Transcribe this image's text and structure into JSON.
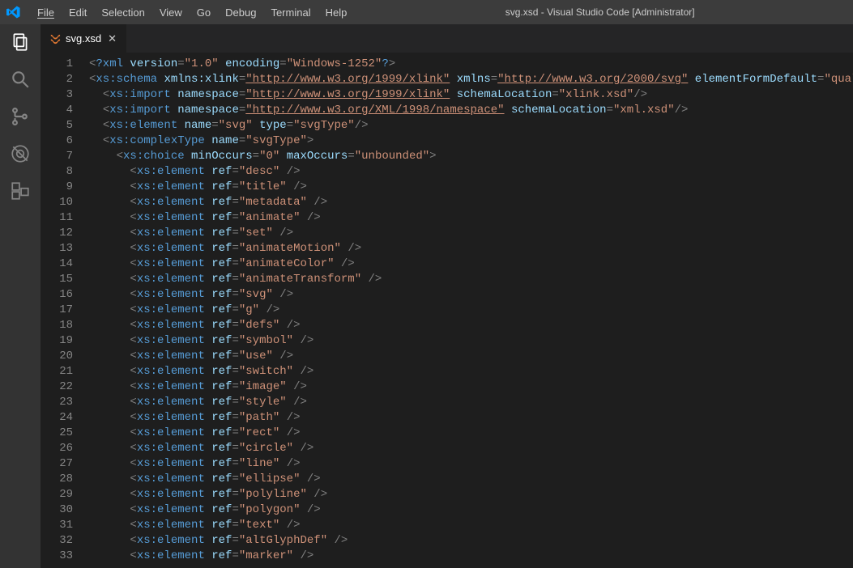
{
  "titlebar": {
    "title": "svg.xsd - Visual Studio Code [Administrator]",
    "menu": [
      "File",
      "Edit",
      "Selection",
      "View",
      "Go",
      "Debug",
      "Terminal",
      "Help"
    ]
  },
  "activitybar": {
    "items": [
      "explorer-icon",
      "search-icon",
      "source-control-icon",
      "debug-icon",
      "extensions-icon"
    ]
  },
  "tabs": [
    {
      "label": "svg.xsd",
      "icon": "xml-icon"
    }
  ],
  "indent": "  ",
  "code_lines": [
    {
      "n": 1,
      "i": 0,
      "t": [
        [
          "punc",
          "<"
        ],
        [
          "pi",
          "?xml"
        ],
        [
          "plain",
          " "
        ],
        [
          "attr",
          "version"
        ],
        [
          "punc",
          "="
        ],
        [
          "str",
          "\"1.0\""
        ],
        [
          "plain",
          " "
        ],
        [
          "attr",
          "encoding"
        ],
        [
          "punc",
          "="
        ],
        [
          "str",
          "\"Windows-1252\""
        ],
        [
          "pi",
          "?"
        ],
        [
          "punc",
          ">"
        ]
      ]
    },
    {
      "n": 2,
      "i": 0,
      "t": [
        [
          "punc",
          "<"
        ],
        [
          "tag",
          "xs:schema"
        ],
        [
          "plain",
          " "
        ],
        [
          "attr",
          "xmlns:xlink"
        ],
        [
          "punc",
          "="
        ],
        [
          "url",
          "\"http://www.w3.org/1999/xlink\""
        ],
        [
          "plain",
          " "
        ],
        [
          "attr",
          "xmlns"
        ],
        [
          "punc",
          "="
        ],
        [
          "url",
          "\"http://www.w3.org/2000/svg\""
        ],
        [
          "plain",
          " "
        ],
        [
          "attr",
          "elementFormDefault"
        ],
        [
          "punc",
          "="
        ],
        [
          "str",
          "\"qualified\""
        ]
      ]
    },
    {
      "n": 3,
      "i": 1,
      "t": [
        [
          "punc",
          "<"
        ],
        [
          "tag",
          "xs:import"
        ],
        [
          "plain",
          " "
        ],
        [
          "attr",
          "namespace"
        ],
        [
          "punc",
          "="
        ],
        [
          "url",
          "\"http://www.w3.org/1999/xlink\""
        ],
        [
          "plain",
          " "
        ],
        [
          "attr",
          "schemaLocation"
        ],
        [
          "punc",
          "="
        ],
        [
          "str",
          "\"xlink.xsd\""
        ],
        [
          "punc",
          "/>"
        ]
      ]
    },
    {
      "n": 4,
      "i": 1,
      "t": [
        [
          "punc",
          "<"
        ],
        [
          "tag",
          "xs:import"
        ],
        [
          "plain",
          " "
        ],
        [
          "attr",
          "namespace"
        ],
        [
          "punc",
          "="
        ],
        [
          "url",
          "\"http://www.w3.org/XML/1998/namespace\""
        ],
        [
          "plain",
          " "
        ],
        [
          "attr",
          "schemaLocation"
        ],
        [
          "punc",
          "="
        ],
        [
          "str",
          "\"xml.xsd\""
        ],
        [
          "punc",
          "/>"
        ]
      ]
    },
    {
      "n": 5,
      "i": 1,
      "t": [
        [
          "punc",
          "<"
        ],
        [
          "tag",
          "xs:element"
        ],
        [
          "plain",
          " "
        ],
        [
          "attr",
          "name"
        ],
        [
          "punc",
          "="
        ],
        [
          "str",
          "\"svg\""
        ],
        [
          "plain",
          " "
        ],
        [
          "attr",
          "type"
        ],
        [
          "punc",
          "="
        ],
        [
          "str",
          "\"svgType\""
        ],
        [
          "punc",
          "/>"
        ]
      ]
    },
    {
      "n": 6,
      "i": 1,
      "t": [
        [
          "punc",
          "<"
        ],
        [
          "tag",
          "xs:complexType"
        ],
        [
          "plain",
          " "
        ],
        [
          "attr",
          "name"
        ],
        [
          "punc",
          "="
        ],
        [
          "str",
          "\"svgType\""
        ],
        [
          "punc",
          ">"
        ]
      ]
    },
    {
      "n": 7,
      "i": 2,
      "t": [
        [
          "punc",
          "<"
        ],
        [
          "tag",
          "xs:choice"
        ],
        [
          "plain",
          " "
        ],
        [
          "attr",
          "minOccurs"
        ],
        [
          "punc",
          "="
        ],
        [
          "str",
          "\"0\""
        ],
        [
          "plain",
          " "
        ],
        [
          "attr",
          "maxOccurs"
        ],
        [
          "punc",
          "="
        ],
        [
          "str",
          "\"unbounded\""
        ],
        [
          "punc",
          ">"
        ]
      ]
    },
    {
      "n": 8,
      "i": 3,
      "t": [
        [
          "punc",
          "<"
        ],
        [
          "tag",
          "xs:element"
        ],
        [
          "plain",
          " "
        ],
        [
          "attr",
          "ref"
        ],
        [
          "punc",
          "="
        ],
        [
          "str",
          "\"desc\""
        ],
        [
          "plain",
          " "
        ],
        [
          "punc",
          "/>"
        ]
      ]
    },
    {
      "n": 9,
      "i": 3,
      "t": [
        [
          "punc",
          "<"
        ],
        [
          "tag",
          "xs:element"
        ],
        [
          "plain",
          " "
        ],
        [
          "attr",
          "ref"
        ],
        [
          "punc",
          "="
        ],
        [
          "str",
          "\"title\""
        ],
        [
          "plain",
          " "
        ],
        [
          "punc",
          "/>"
        ]
      ]
    },
    {
      "n": 10,
      "i": 3,
      "t": [
        [
          "punc",
          "<"
        ],
        [
          "tag",
          "xs:element"
        ],
        [
          "plain",
          " "
        ],
        [
          "attr",
          "ref"
        ],
        [
          "punc",
          "="
        ],
        [
          "str",
          "\"metadata\""
        ],
        [
          "plain",
          " "
        ],
        [
          "punc",
          "/>"
        ]
      ]
    },
    {
      "n": 11,
      "i": 3,
      "t": [
        [
          "punc",
          "<"
        ],
        [
          "tag",
          "xs:element"
        ],
        [
          "plain",
          " "
        ],
        [
          "attr",
          "ref"
        ],
        [
          "punc",
          "="
        ],
        [
          "str",
          "\"animate\""
        ],
        [
          "plain",
          " "
        ],
        [
          "punc",
          "/>"
        ]
      ]
    },
    {
      "n": 12,
      "i": 3,
      "t": [
        [
          "punc",
          "<"
        ],
        [
          "tag",
          "xs:element"
        ],
        [
          "plain",
          " "
        ],
        [
          "attr",
          "ref"
        ],
        [
          "punc",
          "="
        ],
        [
          "str",
          "\"set\""
        ],
        [
          "plain",
          " "
        ],
        [
          "punc",
          "/>"
        ]
      ]
    },
    {
      "n": 13,
      "i": 3,
      "t": [
        [
          "punc",
          "<"
        ],
        [
          "tag",
          "xs:element"
        ],
        [
          "plain",
          " "
        ],
        [
          "attr",
          "ref"
        ],
        [
          "punc",
          "="
        ],
        [
          "str",
          "\"animateMotion\""
        ],
        [
          "plain",
          " "
        ],
        [
          "punc",
          "/>"
        ]
      ]
    },
    {
      "n": 14,
      "i": 3,
      "t": [
        [
          "punc",
          "<"
        ],
        [
          "tag",
          "xs:element"
        ],
        [
          "plain",
          " "
        ],
        [
          "attr",
          "ref"
        ],
        [
          "punc",
          "="
        ],
        [
          "str",
          "\"animateColor\""
        ],
        [
          "plain",
          " "
        ],
        [
          "punc",
          "/>"
        ]
      ]
    },
    {
      "n": 15,
      "i": 3,
      "t": [
        [
          "punc",
          "<"
        ],
        [
          "tag",
          "xs:element"
        ],
        [
          "plain",
          " "
        ],
        [
          "attr",
          "ref"
        ],
        [
          "punc",
          "="
        ],
        [
          "str",
          "\"animateTransform\""
        ],
        [
          "plain",
          " "
        ],
        [
          "punc",
          "/>"
        ]
      ]
    },
    {
      "n": 16,
      "i": 3,
      "t": [
        [
          "punc",
          "<"
        ],
        [
          "tag",
          "xs:element"
        ],
        [
          "plain",
          " "
        ],
        [
          "attr",
          "ref"
        ],
        [
          "punc",
          "="
        ],
        [
          "str",
          "\"svg\""
        ],
        [
          "plain",
          " "
        ],
        [
          "punc",
          "/>"
        ]
      ]
    },
    {
      "n": 17,
      "i": 3,
      "t": [
        [
          "punc",
          "<"
        ],
        [
          "tag",
          "xs:element"
        ],
        [
          "plain",
          " "
        ],
        [
          "attr",
          "ref"
        ],
        [
          "punc",
          "="
        ],
        [
          "str",
          "\"g\""
        ],
        [
          "plain",
          " "
        ],
        [
          "punc",
          "/>"
        ]
      ]
    },
    {
      "n": 18,
      "i": 3,
      "t": [
        [
          "punc",
          "<"
        ],
        [
          "tag",
          "xs:element"
        ],
        [
          "plain",
          " "
        ],
        [
          "attr",
          "ref"
        ],
        [
          "punc",
          "="
        ],
        [
          "str",
          "\"defs\""
        ],
        [
          "plain",
          " "
        ],
        [
          "punc",
          "/>"
        ]
      ]
    },
    {
      "n": 19,
      "i": 3,
      "t": [
        [
          "punc",
          "<"
        ],
        [
          "tag",
          "xs:element"
        ],
        [
          "plain",
          " "
        ],
        [
          "attr",
          "ref"
        ],
        [
          "punc",
          "="
        ],
        [
          "str",
          "\"symbol\""
        ],
        [
          "plain",
          " "
        ],
        [
          "punc",
          "/>"
        ]
      ]
    },
    {
      "n": 20,
      "i": 3,
      "t": [
        [
          "punc",
          "<"
        ],
        [
          "tag",
          "xs:element"
        ],
        [
          "plain",
          " "
        ],
        [
          "attr",
          "ref"
        ],
        [
          "punc",
          "="
        ],
        [
          "str",
          "\"use\""
        ],
        [
          "plain",
          " "
        ],
        [
          "punc",
          "/>"
        ]
      ]
    },
    {
      "n": 21,
      "i": 3,
      "t": [
        [
          "punc",
          "<"
        ],
        [
          "tag",
          "xs:element"
        ],
        [
          "plain",
          " "
        ],
        [
          "attr",
          "ref"
        ],
        [
          "punc",
          "="
        ],
        [
          "str",
          "\"switch\""
        ],
        [
          "plain",
          " "
        ],
        [
          "punc",
          "/>"
        ]
      ]
    },
    {
      "n": 22,
      "i": 3,
      "t": [
        [
          "punc",
          "<"
        ],
        [
          "tag",
          "xs:element"
        ],
        [
          "plain",
          " "
        ],
        [
          "attr",
          "ref"
        ],
        [
          "punc",
          "="
        ],
        [
          "str",
          "\"image\""
        ],
        [
          "plain",
          " "
        ],
        [
          "punc",
          "/>"
        ]
      ]
    },
    {
      "n": 23,
      "i": 3,
      "t": [
        [
          "punc",
          "<"
        ],
        [
          "tag",
          "xs:element"
        ],
        [
          "plain",
          " "
        ],
        [
          "attr",
          "ref"
        ],
        [
          "punc",
          "="
        ],
        [
          "str",
          "\"style\""
        ],
        [
          "plain",
          " "
        ],
        [
          "punc",
          "/>"
        ]
      ]
    },
    {
      "n": 24,
      "i": 3,
      "t": [
        [
          "punc",
          "<"
        ],
        [
          "tag",
          "xs:element"
        ],
        [
          "plain",
          " "
        ],
        [
          "attr",
          "ref"
        ],
        [
          "punc",
          "="
        ],
        [
          "str",
          "\"path\""
        ],
        [
          "plain",
          " "
        ],
        [
          "punc",
          "/>"
        ]
      ]
    },
    {
      "n": 25,
      "i": 3,
      "t": [
        [
          "punc",
          "<"
        ],
        [
          "tag",
          "xs:element"
        ],
        [
          "plain",
          " "
        ],
        [
          "attr",
          "ref"
        ],
        [
          "punc",
          "="
        ],
        [
          "str",
          "\"rect\""
        ],
        [
          "plain",
          " "
        ],
        [
          "punc",
          "/>"
        ]
      ]
    },
    {
      "n": 26,
      "i": 3,
      "t": [
        [
          "punc",
          "<"
        ],
        [
          "tag",
          "xs:element"
        ],
        [
          "plain",
          " "
        ],
        [
          "attr",
          "ref"
        ],
        [
          "punc",
          "="
        ],
        [
          "str",
          "\"circle\""
        ],
        [
          "plain",
          " "
        ],
        [
          "punc",
          "/>"
        ]
      ]
    },
    {
      "n": 27,
      "i": 3,
      "t": [
        [
          "punc",
          "<"
        ],
        [
          "tag",
          "xs:element"
        ],
        [
          "plain",
          " "
        ],
        [
          "attr",
          "ref"
        ],
        [
          "punc",
          "="
        ],
        [
          "str",
          "\"line\""
        ],
        [
          "plain",
          " "
        ],
        [
          "punc",
          "/>"
        ]
      ]
    },
    {
      "n": 28,
      "i": 3,
      "t": [
        [
          "punc",
          "<"
        ],
        [
          "tag",
          "xs:element"
        ],
        [
          "plain",
          " "
        ],
        [
          "attr",
          "ref"
        ],
        [
          "punc",
          "="
        ],
        [
          "str",
          "\"ellipse\""
        ],
        [
          "plain",
          " "
        ],
        [
          "punc",
          "/>"
        ]
      ]
    },
    {
      "n": 29,
      "i": 3,
      "t": [
        [
          "punc",
          "<"
        ],
        [
          "tag",
          "xs:element"
        ],
        [
          "plain",
          " "
        ],
        [
          "attr",
          "ref"
        ],
        [
          "punc",
          "="
        ],
        [
          "str",
          "\"polyline\""
        ],
        [
          "plain",
          " "
        ],
        [
          "punc",
          "/>"
        ]
      ]
    },
    {
      "n": 30,
      "i": 3,
      "t": [
        [
          "punc",
          "<"
        ],
        [
          "tag",
          "xs:element"
        ],
        [
          "plain",
          " "
        ],
        [
          "attr",
          "ref"
        ],
        [
          "punc",
          "="
        ],
        [
          "str",
          "\"polygon\""
        ],
        [
          "plain",
          " "
        ],
        [
          "punc",
          "/>"
        ]
      ]
    },
    {
      "n": 31,
      "i": 3,
      "t": [
        [
          "punc",
          "<"
        ],
        [
          "tag",
          "xs:element"
        ],
        [
          "plain",
          " "
        ],
        [
          "attr",
          "ref"
        ],
        [
          "punc",
          "="
        ],
        [
          "str",
          "\"text\""
        ],
        [
          "plain",
          " "
        ],
        [
          "punc",
          "/>"
        ]
      ]
    },
    {
      "n": 32,
      "i": 3,
      "t": [
        [
          "punc",
          "<"
        ],
        [
          "tag",
          "xs:element"
        ],
        [
          "plain",
          " "
        ],
        [
          "attr",
          "ref"
        ],
        [
          "punc",
          "="
        ],
        [
          "str",
          "\"altGlyphDef\""
        ],
        [
          "plain",
          " "
        ],
        [
          "punc",
          "/>"
        ]
      ]
    },
    {
      "n": 33,
      "i": 3,
      "t": [
        [
          "punc",
          "<"
        ],
        [
          "tag",
          "xs:element"
        ],
        [
          "plain",
          " "
        ],
        [
          "attr",
          "ref"
        ],
        [
          "punc",
          "="
        ],
        [
          "str",
          "\"marker\""
        ],
        [
          "plain",
          " "
        ],
        [
          "punc",
          "/>"
        ]
      ]
    }
  ]
}
